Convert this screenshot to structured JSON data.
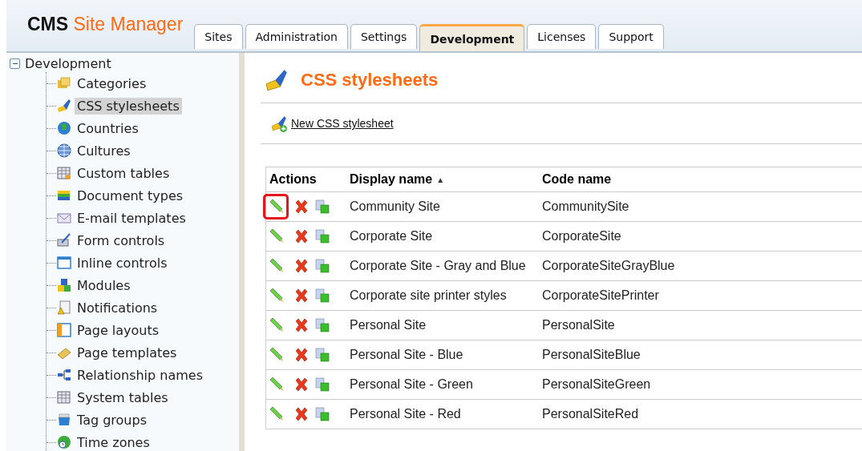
{
  "header": {
    "logo_bold": "CMS",
    "logo_rest": "Site Manager"
  },
  "tabs": [
    {
      "label": "Sites",
      "selected": false
    },
    {
      "label": "Administration",
      "selected": false
    },
    {
      "label": "Settings",
      "selected": false
    },
    {
      "label": "Development",
      "selected": true
    },
    {
      "label": "Licenses",
      "selected": false
    },
    {
      "label": "Support",
      "selected": false
    }
  ],
  "tree": {
    "label": "Development",
    "expanded": true,
    "children": [
      {
        "label": "Categories",
        "selected": false
      },
      {
        "label": "CSS stylesheets",
        "selected": true
      },
      {
        "label": "Countries",
        "selected": false
      },
      {
        "label": "Cultures",
        "selected": false
      },
      {
        "label": "Custom tables",
        "selected": false
      },
      {
        "label": "Document types",
        "selected": false
      },
      {
        "label": "E-mail templates",
        "selected": false
      },
      {
        "label": "Form controls",
        "selected": false
      },
      {
        "label": "Inline controls",
        "selected": false
      },
      {
        "label": "Modules",
        "selected": false
      },
      {
        "label": "Notifications",
        "selected": false
      },
      {
        "label": "Page layouts",
        "selected": false
      },
      {
        "label": "Page templates",
        "selected": false
      },
      {
        "label": "Relationship names",
        "selected": false
      },
      {
        "label": "System tables",
        "selected": false
      },
      {
        "label": "Tag groups",
        "selected": false
      },
      {
        "label": "Time zones",
        "selected": false
      }
    ]
  },
  "page_title": "CSS stylesheets",
  "new_link": "New CSS stylesheet",
  "table": {
    "columns": [
      "Actions",
      "Display name",
      "Code name"
    ],
    "sort_indicator": "▲",
    "rows": [
      {
        "display_name": "Community Site",
        "code_name": "CommunitySite",
        "highlighted": true
      },
      {
        "display_name": "Corporate Site",
        "code_name": "CorporateSite",
        "highlighted": false
      },
      {
        "display_name": "Corporate Site - Gray and Blue",
        "code_name": "CorporateSiteGrayBlue",
        "highlighted": false
      },
      {
        "display_name": "Corporate site printer styles",
        "code_name": "CorporateSitePrinter",
        "highlighted": false
      },
      {
        "display_name": "Personal Site",
        "code_name": "PersonalSite",
        "highlighted": false
      },
      {
        "display_name": "Personal Site - Blue",
        "code_name": "PersonalSiteBlue",
        "highlighted": false
      },
      {
        "display_name": "Personal Site - Green",
        "code_name": "PersonalSiteGreen",
        "highlighted": false
      },
      {
        "display_name": "Personal Site - Red",
        "code_name": "PersonalSiteRed",
        "highlighted": false
      }
    ]
  }
}
